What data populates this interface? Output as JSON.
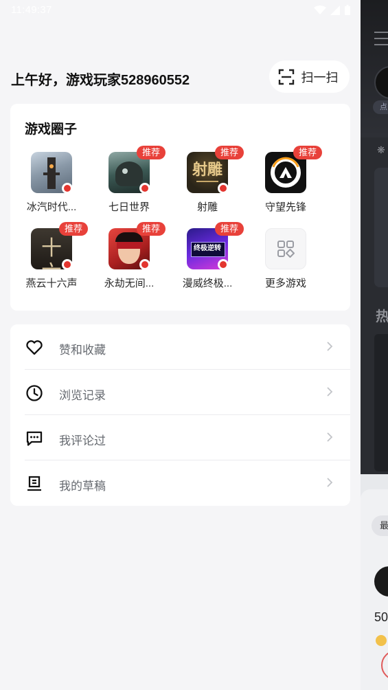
{
  "status_bar": {
    "time": "11:49:37"
  },
  "header": {
    "greeting": "上午好，游戏玩家528960552",
    "scan_label": "扫一扫"
  },
  "games": {
    "title": "游戏圈子",
    "badge_label": "推荐",
    "items": [
      {
        "name": "冰汽时代...",
        "recommended": false,
        "icon": "frostpunk-icon",
        "color": "#8a99a8"
      },
      {
        "name": "七日世界",
        "recommended": true,
        "icon": "once-human-icon",
        "color": "#3c5a55"
      },
      {
        "name": "射雕",
        "recommended": true,
        "icon": "shediao-icon",
        "color": "#2a2418"
      },
      {
        "name": "守望先锋",
        "recommended": true,
        "icon": "overwatch-icon",
        "color": "#1a1a1a"
      },
      {
        "name": "燕云十六声",
        "recommended": true,
        "icon": "yanyun-icon",
        "color": "#2b2620"
      },
      {
        "name": "永劫无间...",
        "recommended": true,
        "icon": "naraka-icon",
        "color": "#c42a2a"
      },
      {
        "name": "漫威终极...",
        "recommended": true,
        "icon": "marvel-icon",
        "color": "#5a2ad0"
      },
      {
        "name": "更多游戏",
        "recommended": false,
        "icon": "more-games-icon",
        "color": "#f6f6f7"
      }
    ]
  },
  "menu": {
    "items": [
      {
        "label": "赞和收藏",
        "icon": "heart-icon"
      },
      {
        "label": "浏览记录",
        "icon": "clock-icon"
      },
      {
        "label": "我评论过",
        "icon": "comment-icon"
      },
      {
        "label": "我的草稿",
        "icon": "draft-icon"
      }
    ]
  },
  "side_panel": {
    "chip_text": "点",
    "heading": "热",
    "pill_text": "最",
    "number_text": "50"
  },
  "colors": {
    "badge": "#e8413a",
    "background": "#f5f5f7",
    "card": "#ffffff"
  }
}
